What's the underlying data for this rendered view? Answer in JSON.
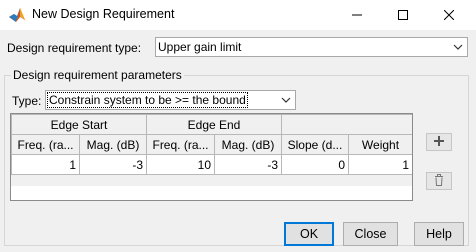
{
  "window": {
    "title": "New Design Requirement"
  },
  "requirement_type": {
    "label": "Design requirement type:",
    "value": "Upper gain limit"
  },
  "parameters": {
    "title": "Design requirement parameters",
    "type_label": "Type:",
    "type_value": "Constrain system to be >= the bound"
  },
  "table": {
    "group_headers": [
      "Edge Start",
      "Edge End"
    ],
    "columns": [
      "Freq. (ra...",
      "Mag. (dB)",
      "Freq. (ra...",
      "Mag. (dB)",
      "Slope (d...",
      "Weight"
    ],
    "rows": [
      [
        "1",
        "-3",
        "10",
        "-3",
        "0",
        "1"
      ]
    ]
  },
  "buttons": {
    "ok": "OK",
    "close": "Close",
    "help": "Help"
  },
  "colors": {
    "title_bar": "#ffffff",
    "dialog_bg": "#f0f0f0",
    "default_button_border": "#0078d7"
  },
  "icons": [
    "matlab-icon",
    "minimize-icon",
    "maximize-icon",
    "close-icon",
    "chevron-down-icon",
    "plus-icon",
    "trash-icon"
  ]
}
